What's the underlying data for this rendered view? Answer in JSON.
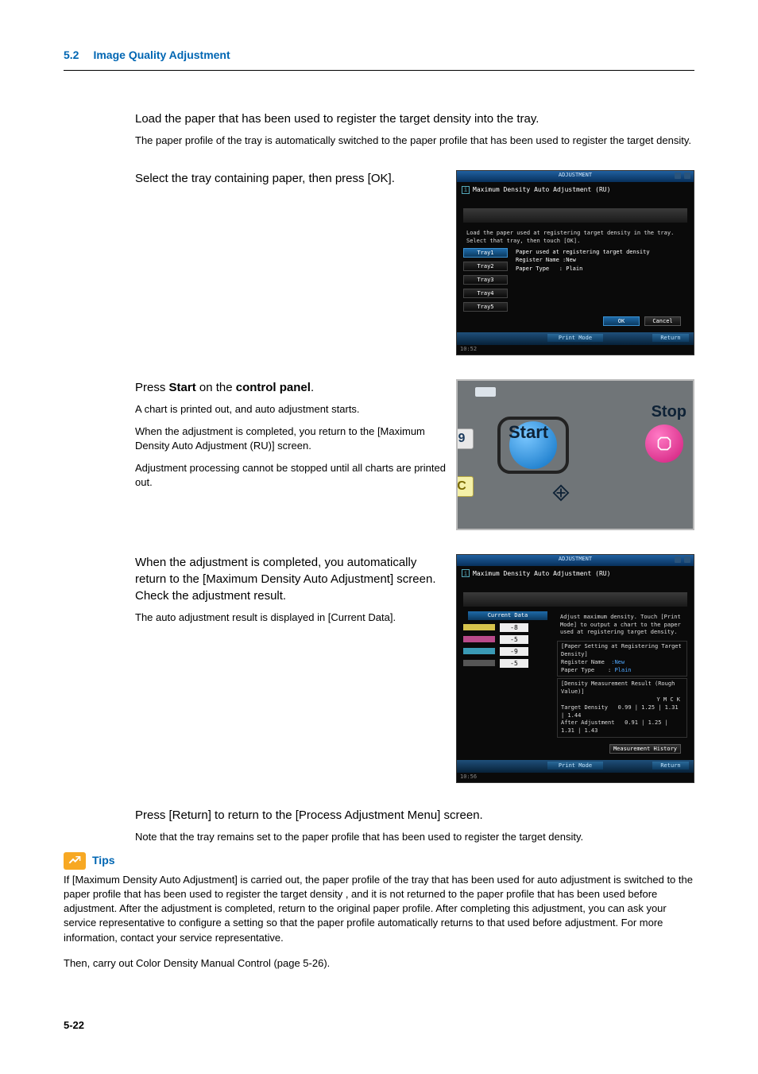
{
  "header": {
    "section_num": "5.2",
    "title": "Image Quality Adjustment"
  },
  "step1": {
    "title": "Load the paper that has been used to register the target density into the tray.",
    "text": "The paper profile of the tray is automatically switched to the paper profile that has been used to register the target density."
  },
  "step2": {
    "title": "Select the tray containing paper, then press [OK].",
    "screen": {
      "adjustment_label": "ADJUSTMENT",
      "screen_title": "Maximum Density Auto Adjustment (RU)",
      "instruction": "Load the paper used at registering target density in the tray. Select that tray, then touch [OK].",
      "paper_box_title": "Paper used at registering target density",
      "register_name_label": "Register Name",
      "register_name_value": ":New",
      "paper_type_label": "Paper Type",
      "paper_type_value": "Plain",
      "trays": [
        "Tray1",
        "Tray2",
        "Tray3",
        "Tray4",
        "Tray5"
      ],
      "ok_btn": "OK",
      "cancel_btn": "Cancel",
      "print_mode_btn": "Print Mode",
      "return_btn": "Return",
      "timestamp": "10:52"
    }
  },
  "step3": {
    "title_pre": "Press ",
    "title_b1": "Start",
    "title_mid": " on the ",
    "title_b2": "control panel",
    "title_post": ".",
    "p1": "A chart is printed out, and auto adjustment starts.",
    "p2": "When the adjustment is completed, you return to the [Maximum Density Auto Adjustment (RU)] screen.",
    "p3": "Adjustment processing cannot be stopped until all charts are printed out.",
    "panel": {
      "start": "Start",
      "stop": "Stop",
      "nine": "9",
      "c": "C"
    }
  },
  "step4": {
    "title": "When the adjustment is completed, you automatically return to the [Maximum Density Auto Adjustment] screen. Check the adjustment result.",
    "text": "The auto adjustment result is displayed in [Current Data].",
    "screen": {
      "adjustment_label": "ADJUSTMENT",
      "screen_title": "Maximum Density Auto Adjustment (RU)",
      "message": "Adjust maximum density. Touch [Print Mode] to output a chart to the paper used at registering target density.",
      "current_data_label": "Current Data",
      "values": [
        "-8",
        "-5",
        "-9",
        "-5"
      ],
      "paper_setting_title": "[Paper Setting at Registering Target Density]",
      "register_name_label": "Register Name",
      "register_name_value": ":New",
      "paper_type_label": "Paper Type",
      "paper_type_value": "Plain",
      "density_result_title": "[Density Measurement Result (Rough Value)]",
      "density_headers": "Y    M    C    K",
      "target_density_label": "Target Density",
      "target_density_vals": "0.99 | 1.25 | 1.31 | 1.44",
      "after_adj_label": "After Adjustment",
      "after_adj_vals": "0.91 | 1.25 | 1.31 | 1.43",
      "meas_history_btn": "Measurement History",
      "print_mode_btn": "Print Mode",
      "return_btn": "Return",
      "timestamp": "10:56"
    }
  },
  "step5": {
    "title": "Press [Return] to return to the [Process Adjustment Menu] screen.",
    "text": "Note that the tray remains set to the paper profile that has been used to register the target density."
  },
  "tips": {
    "label": "Tips",
    "body": "If [Maximum Density Auto Adjustment] is carried out, the paper profile of the tray that has been used for auto adjustment is switched to the paper profile that has been used to register the target density , and it is not returned to the paper profile that has been used before adjustment. After the adjustment is completed, return to the original paper profile. After completing this adjustment, you can ask your service representative to configure a setting so that the paper profile automatically returns to that used before adjustment. For more information, contact your service representative."
  },
  "closing": "Then, carry out Color Density Manual Control (page 5-26).",
  "footer": {
    "page": "5-22"
  }
}
